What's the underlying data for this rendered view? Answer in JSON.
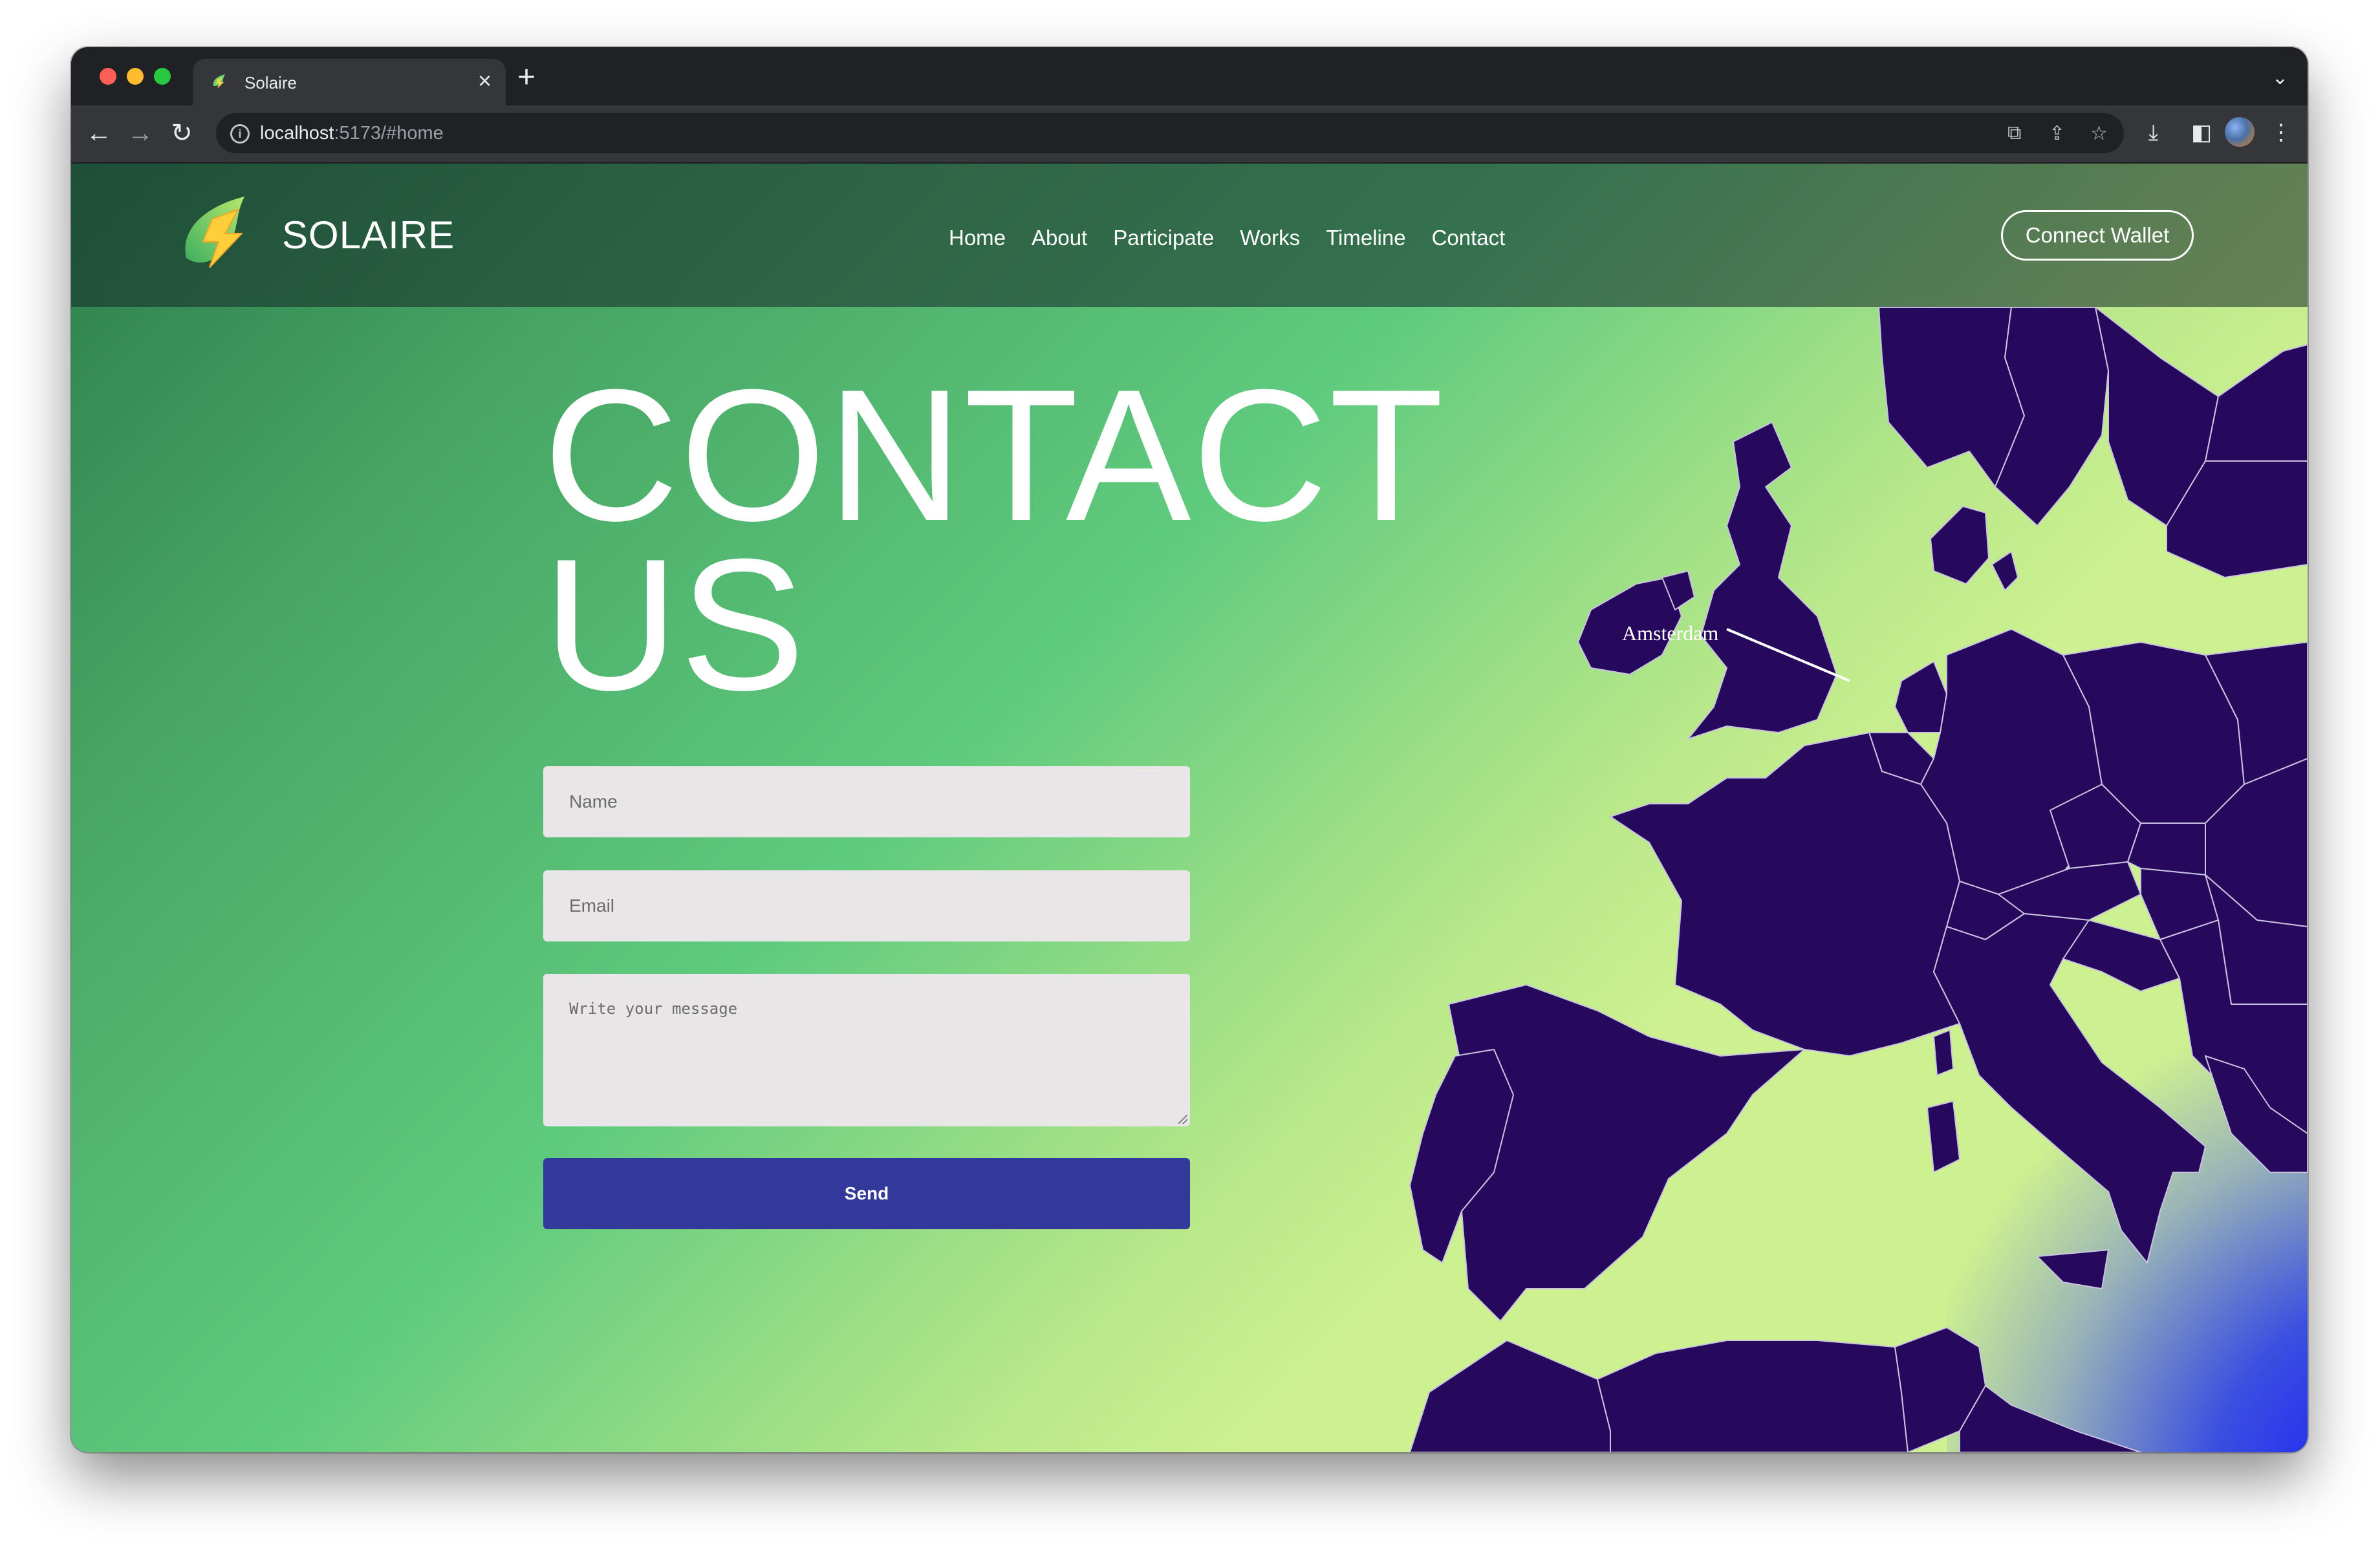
{
  "browser": {
    "tab_title": "Solaire",
    "tab_close": "×",
    "new_tab": "+",
    "url_host": "localhost",
    "url_rest": ":5173/#home",
    "icons": [
      "back-arrow-icon",
      "forward-arrow-icon",
      "reload-icon",
      "info-icon",
      "translate-icon",
      "share-icon",
      "star-icon",
      "download-icon",
      "sidebar-icon",
      "profile-avatar",
      "menu-icon"
    ]
  },
  "header": {
    "logo_text": "SOLAIRE",
    "nav": [
      "Home",
      "About",
      "Participate",
      "Works",
      "Timeline",
      "Contact"
    ],
    "wallet_button": "Connect Wallet"
  },
  "hero": {
    "title_line1": "CONTACT",
    "title_line2": "US"
  },
  "form": {
    "name_placeholder": "Name",
    "email_placeholder": "Email",
    "message_placeholder": "Write your message",
    "send_label": "Send"
  },
  "map": {
    "city_label": "Amsterdam",
    "land_color": "#26095c",
    "border_color": "#c9c3e0"
  },
  "colors": {
    "accent_button": "#32399a",
    "gradient_green": "#5fcb7e",
    "gradient_lime": "#cdf190",
    "gradient_blue": "#1212ff"
  }
}
